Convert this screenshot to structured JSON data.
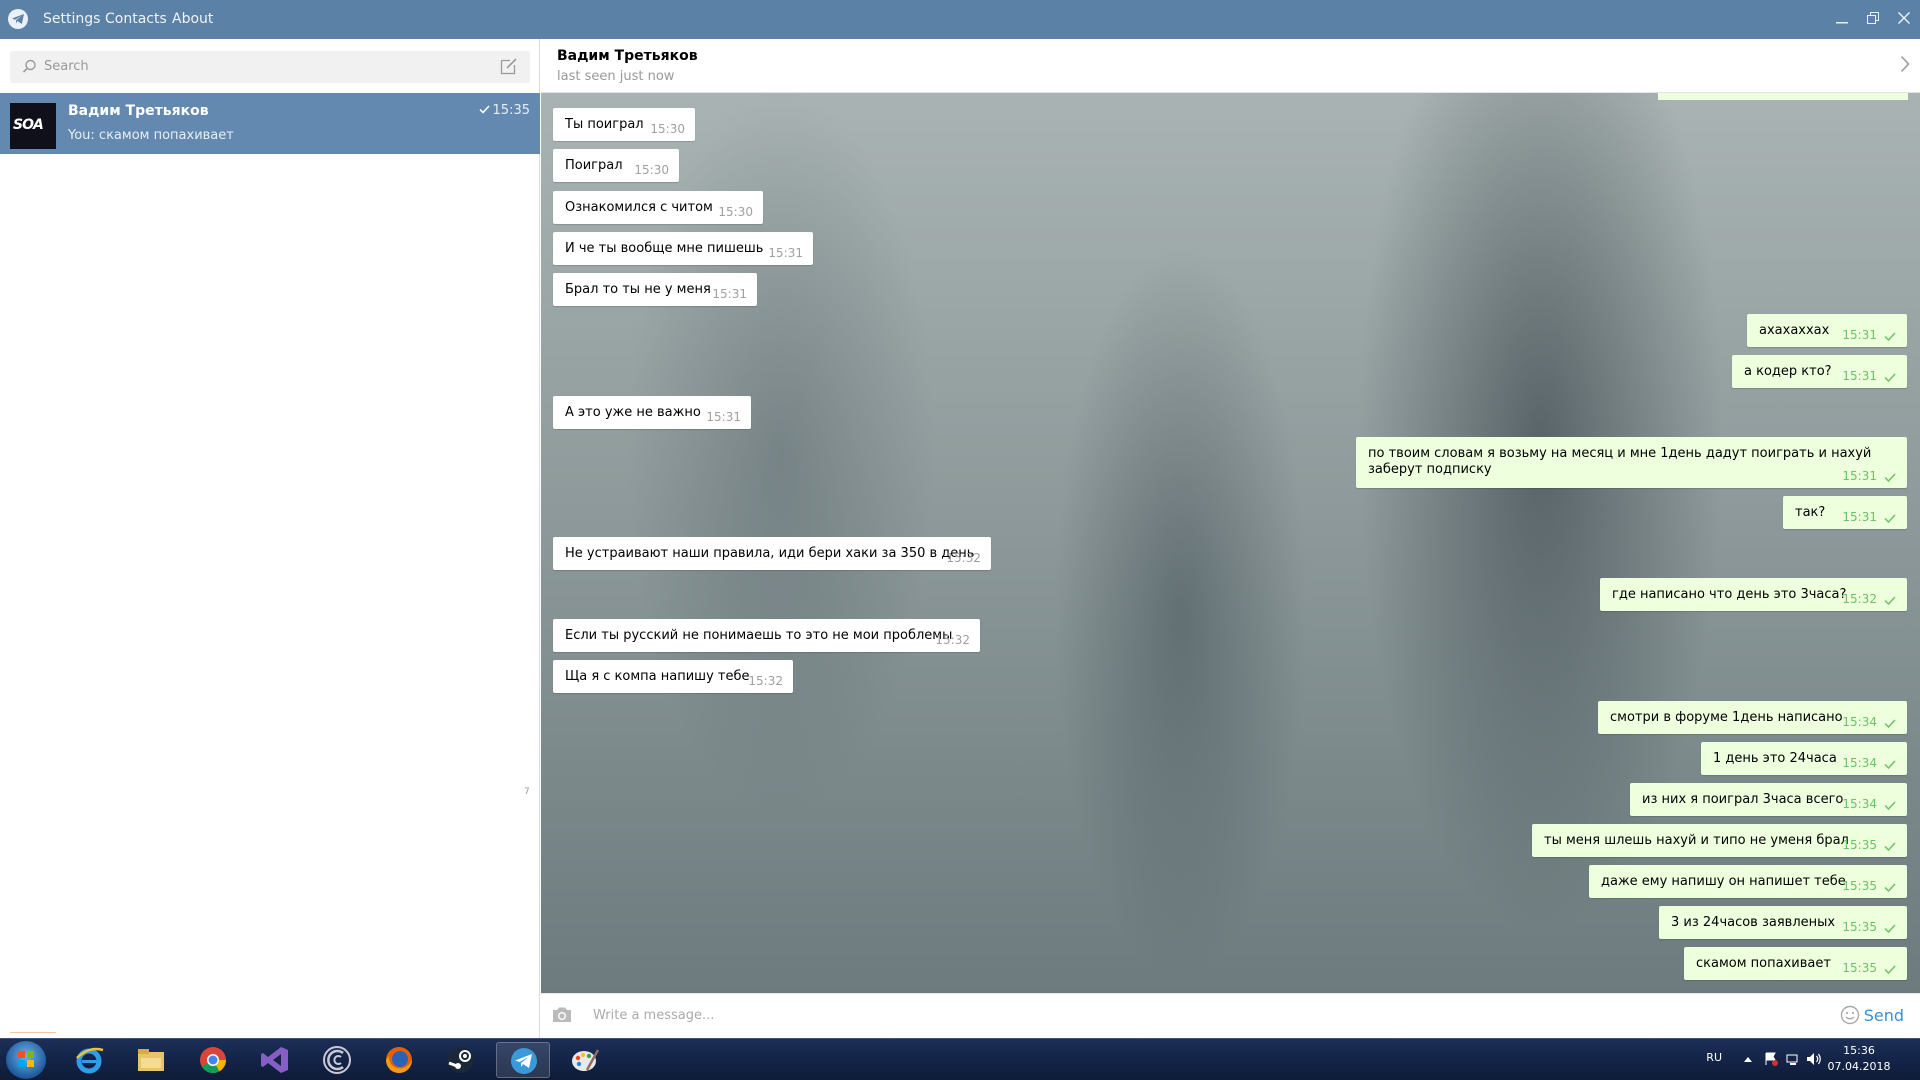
{
  "titlebar": {
    "menu": [
      "Settings",
      "Contacts",
      "About"
    ],
    "icons": [
      "telegram-logo",
      "minimize-icon",
      "restore-icon",
      "close-icon"
    ]
  },
  "search": {
    "placeholder": "Search"
  },
  "dialogs": [
    {
      "name": "Вадим Третьяков",
      "avatar_text": "SOA",
      "preview": "You: скамом попахивает",
      "time": "15:35",
      "read": true
    }
  ],
  "left_scroll_marker": "7",
  "chat": {
    "name": "Вадим Третьяков",
    "status": "last seen just now"
  },
  "messages": [
    {
      "dir": "in",
      "text": "Ты поиграл",
      "time": "15:30"
    },
    {
      "dir": "in",
      "text": "Поиграл",
      "time": "15:30"
    },
    {
      "dir": "in",
      "text": "Ознакомился с читом",
      "time": "15:30"
    },
    {
      "dir": "in",
      "text": "И че ты вообще мне пишешь",
      "time": "15:31"
    },
    {
      "dir": "in",
      "text": "Брал то ты не у меня",
      "time": "15:31"
    },
    {
      "dir": "out",
      "text": "ахахаххах",
      "time": "15:31"
    },
    {
      "dir": "out",
      "text": "а кодер кто?",
      "time": "15:31"
    },
    {
      "dir": "in",
      "text": "А это уже не важно",
      "time": "15:31"
    },
    {
      "dir": "out",
      "text": "по твоим словам я возьму на месяц и мне 1день дадут поиграть и нахуй заберут подписку",
      "time": "15:31"
    },
    {
      "dir": "out",
      "text": "так?",
      "time": "15:31"
    },
    {
      "dir": "in",
      "text": "Не устраивают наши правила, иди бери хаки за 350 в день",
      "time": "15:32"
    },
    {
      "dir": "out",
      "text": "где написано что день это 3часа?",
      "time": "15:32"
    },
    {
      "dir": "in",
      "text": "Если ты русский не понимаешь то это не мои проблемы",
      "time": "15:32"
    },
    {
      "dir": "in",
      "text": "Ща я с компа напишу тебе",
      "time": "15:32"
    },
    {
      "dir": "out",
      "text": "смотри в форуме 1день написано",
      "time": "15:34"
    },
    {
      "dir": "out",
      "text": "1 день это 24часа",
      "time": "15:34"
    },
    {
      "dir": "out",
      "text": "из них я поиграл 3часа всего",
      "time": "15:34"
    },
    {
      "dir": "out",
      "text": "ты меня шлешь нахуй и типо не уменя брал",
      "time": "15:35"
    },
    {
      "dir": "out",
      "text": "даже ему напишу он напишет тебе",
      "time": "15:35"
    },
    {
      "dir": "out",
      "text": "3 из 24часов заявленых",
      "time": "15:35"
    },
    {
      "dir": "out",
      "text": "скамом попахивает",
      "time": "15:35"
    }
  ],
  "compose": {
    "placeholder": "Write a message...",
    "send_label": "Send"
  },
  "taskbar": {
    "apps": [
      "windows-start",
      "internet-explorer",
      "file-explorer",
      "chrome",
      "visual-studio",
      "cortex",
      "firefox",
      "steam",
      "telegram",
      "paint"
    ],
    "active_app": "telegram",
    "lang": "RU",
    "time": "15:36",
    "date": "07.04.2018"
  },
  "colors": {
    "titlebar": "#5b81a7",
    "selected_dialog": "#6489b0",
    "outgoing_bubble": "#eeffde",
    "incoming_bubble": "#ffffff",
    "send": "#3a8fd0"
  }
}
